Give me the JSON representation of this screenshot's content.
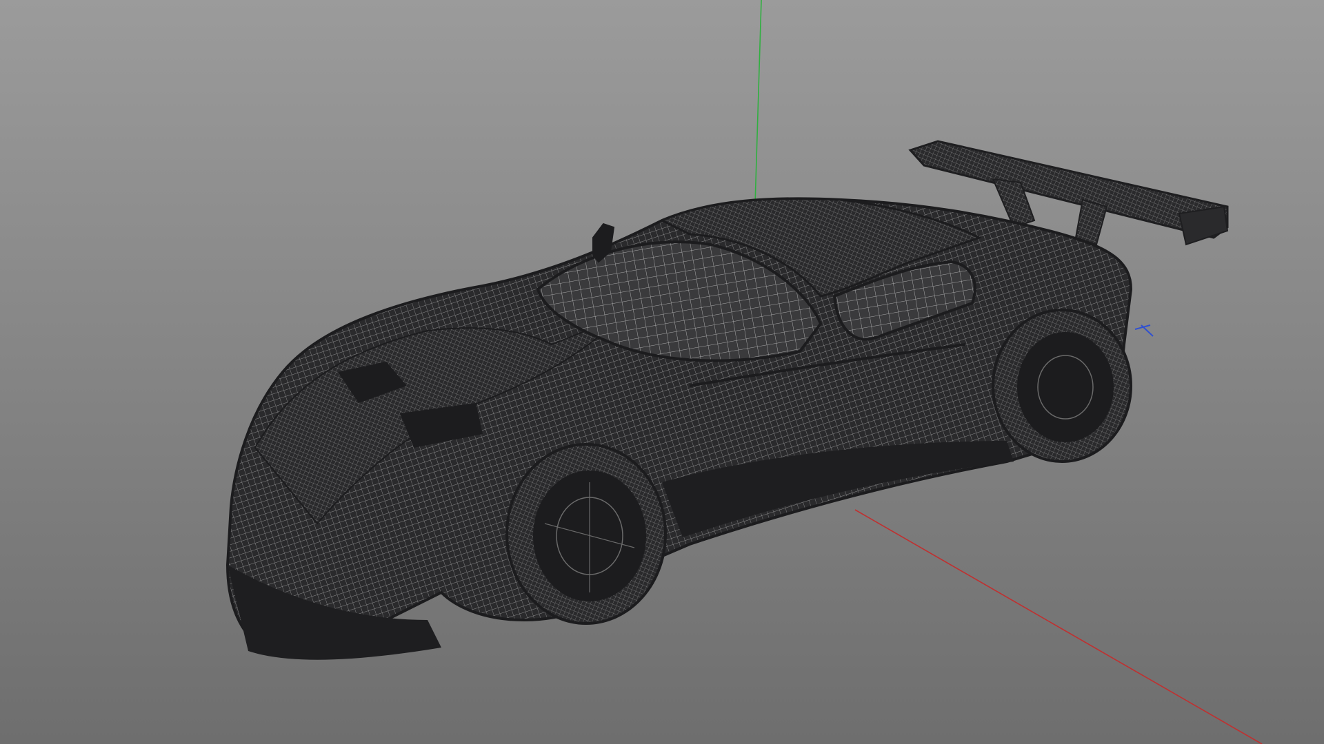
{
  "viewport": {
    "background_top": "#9b9b9b",
    "background_bottom": "#6e6e6e",
    "wireframe_color": "#2a2a2c",
    "mesh_line_color": "#dcdcdc",
    "axes": {
      "x_color": "#c03030",
      "y_color": "#30b040",
      "z_color": "#3050d0"
    },
    "model": {
      "icon": "car-wireframe-model",
      "render_mode": "wireframe"
    }
  }
}
